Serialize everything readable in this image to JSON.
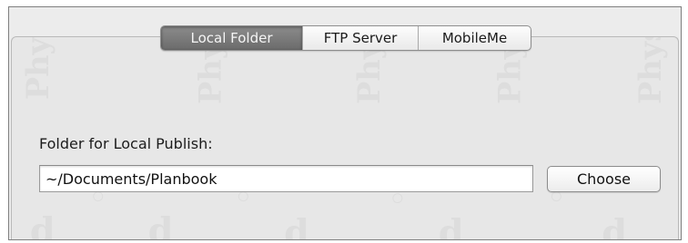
{
  "tabs": [
    {
      "label": "Local Folder",
      "selected": true
    },
    {
      "label": "FTP Server",
      "selected": false
    },
    {
      "label": "MobileMe",
      "selected": false
    }
  ],
  "publish": {
    "folder_label": "Folder for Local Publish:",
    "path_value": "~/Documents/Planbook",
    "choose_label": "Choose"
  },
  "colors": {
    "selected_tab": "#7a7a7a",
    "panel_background": "#e7e7e7",
    "border": "#8e8e8e"
  }
}
